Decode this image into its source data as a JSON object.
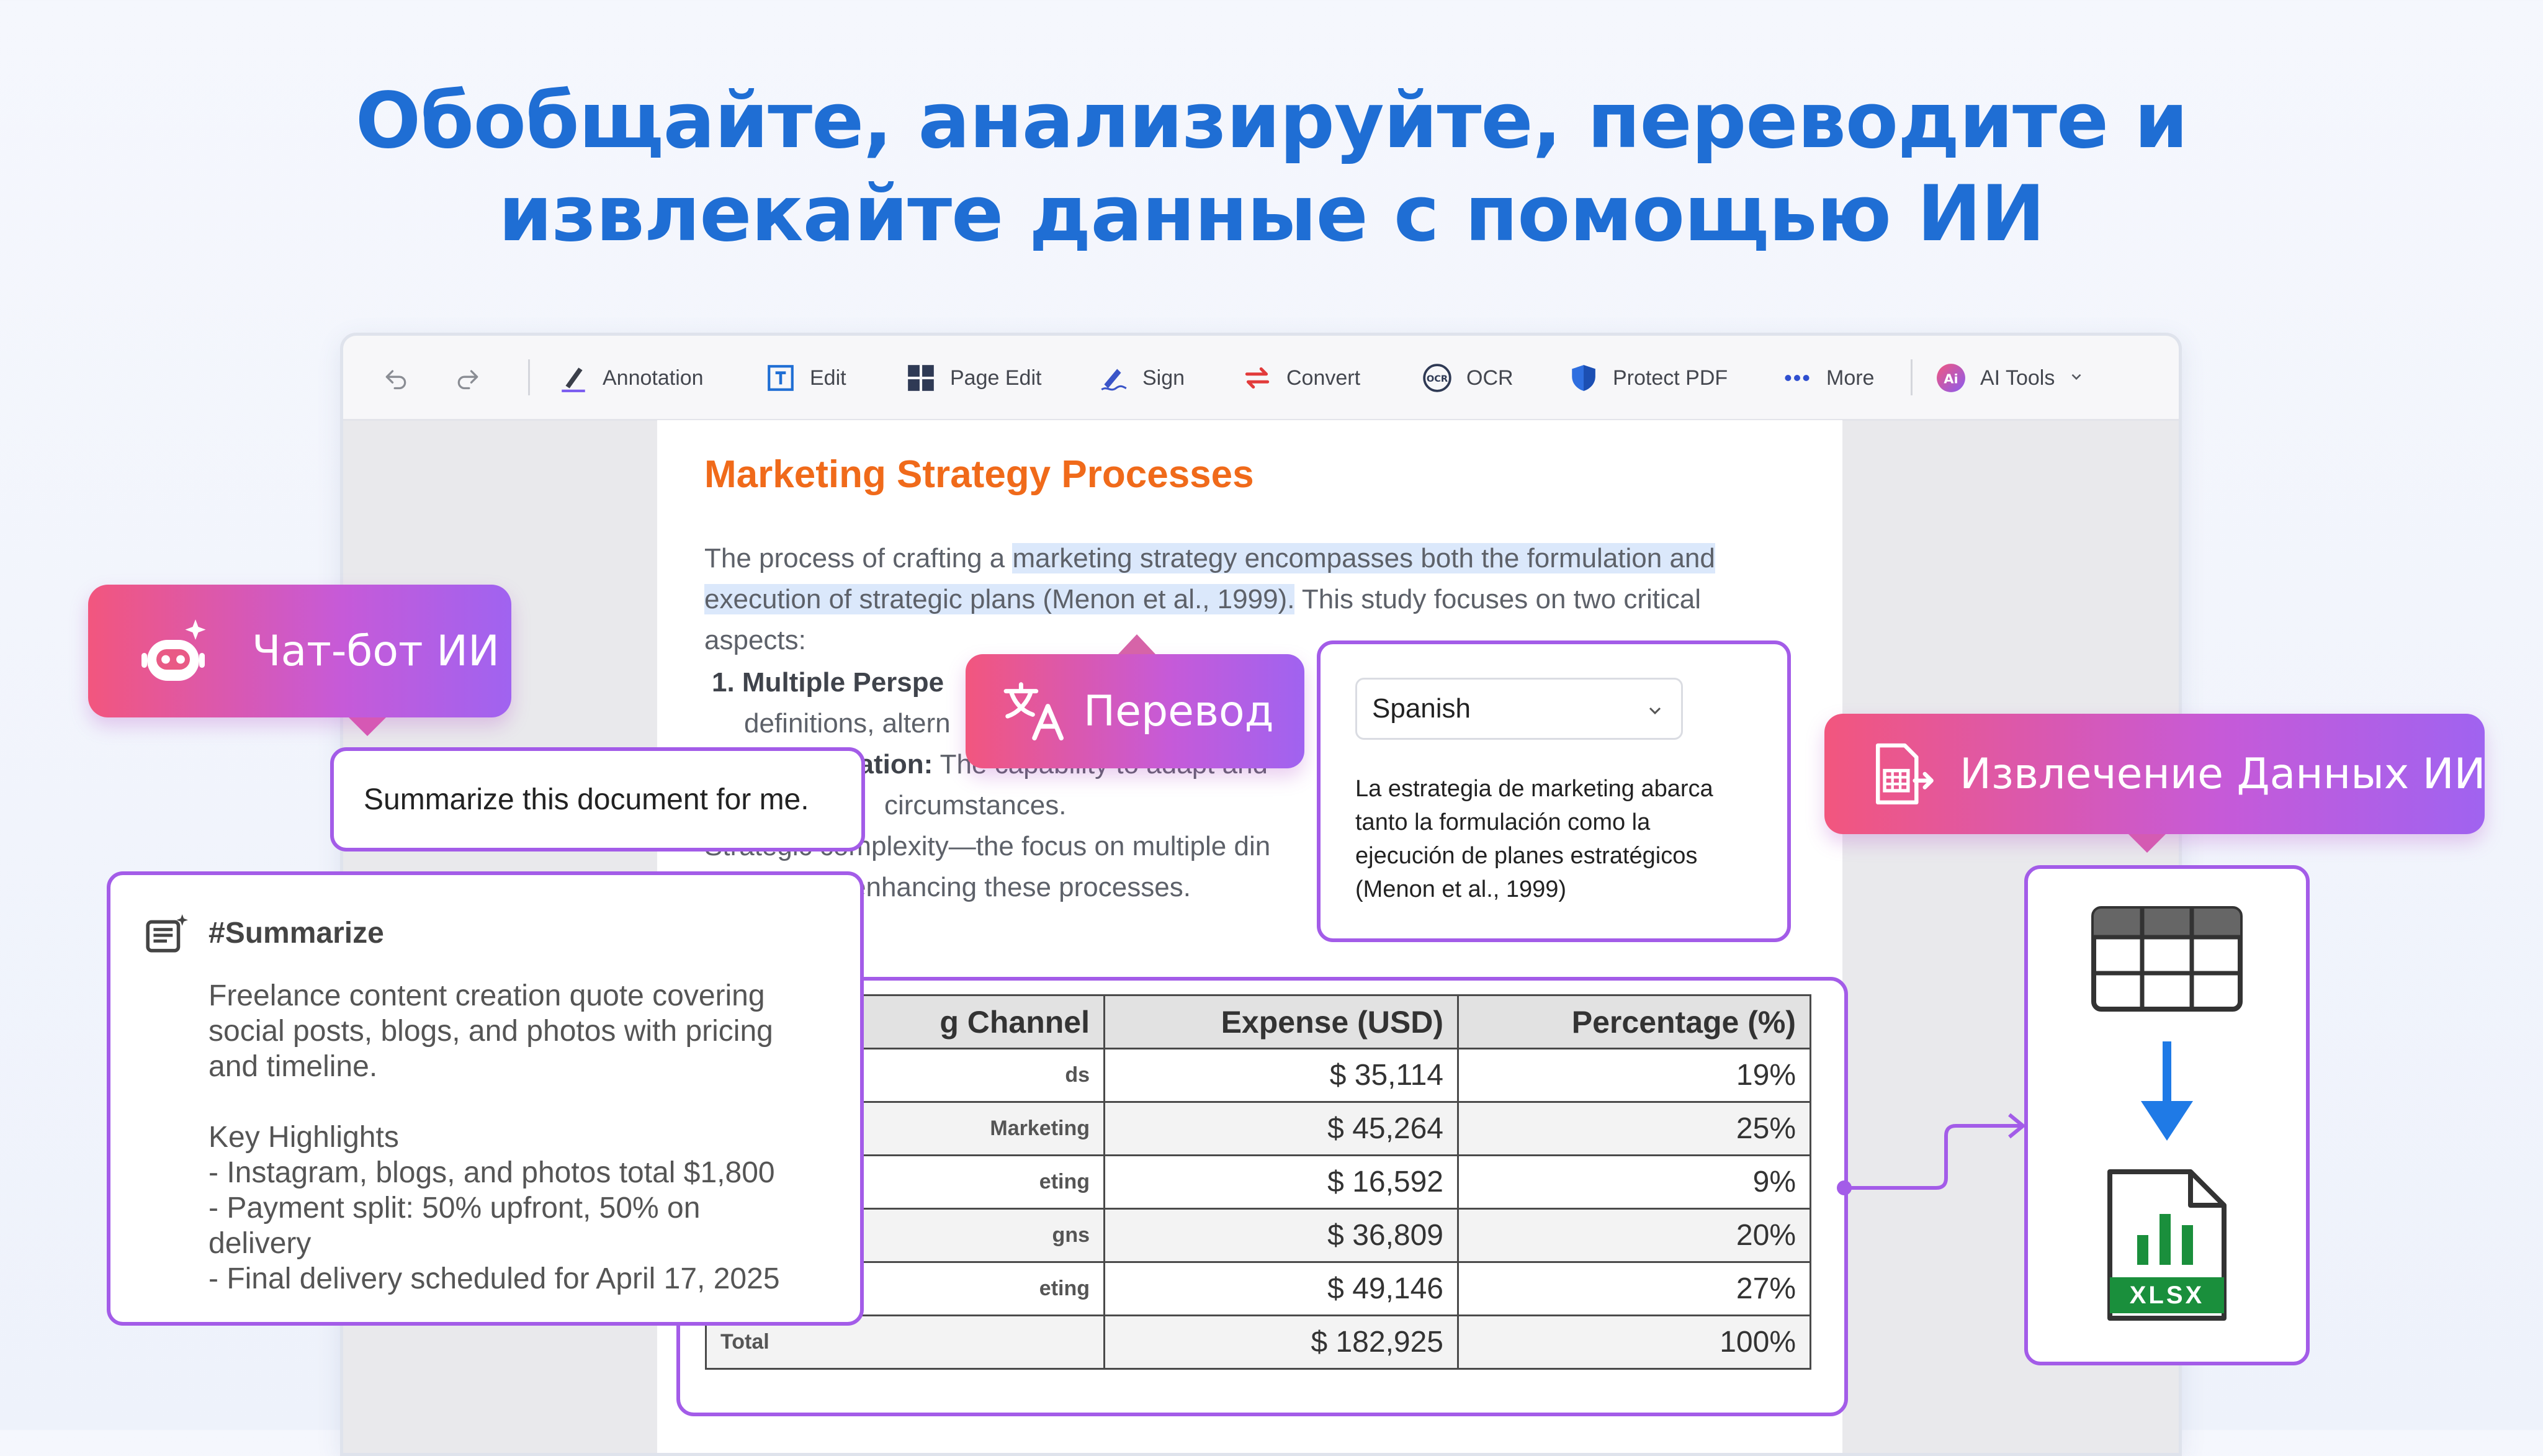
{
  "headline": {
    "line1": "Обобщайте, анализируйте, переводите и",
    "line2": "извлекайте данные с помощью ИИ"
  },
  "toolbar": {
    "items": [
      {
        "label": "Annotation",
        "icon": "pen-icon"
      },
      {
        "label": "Edit",
        "icon": "text-edit-icon"
      },
      {
        "label": "Page Edit",
        "icon": "grid-icon"
      },
      {
        "label": "Sign",
        "icon": "signature-icon"
      },
      {
        "label": "Convert",
        "icon": "convert-icon"
      },
      {
        "label": "OCR",
        "icon": "ocr-icon"
      },
      {
        "label": "Protect PDF",
        "icon": "shield-icon"
      },
      {
        "label": "More",
        "icon": "more-icon"
      },
      {
        "label": "AI Tools",
        "icon": "ai-icon"
      }
    ]
  },
  "document": {
    "title": "Marketing Strategy Processes",
    "p1_a": "The process of crafting a ",
    "p1_hl": "marketing strategy encompasses both the formulation and",
    "p2_hl": "execution of strategic plans (Menon et al., 1999).",
    "p2_b": " This study focuses on two critical",
    "p3": "aspects:",
    "item1": "1. Multiple Perspe",
    "item1_sub": "definitions, altern",
    "item2_a": "sation:",
    "item2_b": " The capability to adapt and",
    "item2_sub": "circumstances.",
    "p4": "Strategic complexity—the focus on multiple din",
    "p5": "enhancing these processes."
  },
  "table": {
    "headers": [
      "g Channel",
      "Expense (USD)",
      "Percentage (%)"
    ],
    "rows": [
      [
        "ds",
        "$ 35,114",
        "19%"
      ],
      [
        "Marketing",
        "$ 45,264",
        "25%"
      ],
      [
        "eting",
        "$ 16,592",
        "9%"
      ],
      [
        "gns",
        "$ 36,809",
        "20%"
      ],
      [
        "eting",
        "$ 49,146",
        "27%"
      ],
      [
        "Total",
        "$ 182,925",
        "100%"
      ]
    ]
  },
  "chatbot": {
    "label": "Чат-бот ИИ"
  },
  "prompt": {
    "text": "Summarize this document for me."
  },
  "summary": {
    "tag": "#Summarize",
    "lines": [
      "Freelance content creation quote covering",
      "social posts, blogs, and photos with pricing",
      "and timeline.",
      "",
      "Key Highlights",
      "- Instagram, blogs, and photos total $1,800",
      "- Payment split: 50% upfront, 50% on",
      "delivery",
      "- Final delivery scheduled for April 17, 2025"
    ]
  },
  "translate": {
    "label": "Перевод",
    "language": "Spanish",
    "result_lines": [
      "La estrategia de marketing abarca",
      "tanto la formulación como la",
      "ejecución de planes estratégicos",
      "(Menon et al., 1999)"
    ]
  },
  "extract": {
    "label": "Извлечение Данных ИИ",
    "file_badge": "XLSX"
  },
  "colors": {
    "headline": "#1f6ed4",
    "doc_title": "#f06a1a",
    "accent_purple": "#a35ce8",
    "gradient_start": "#f2567e",
    "gradient_end": "#a063f0",
    "highlight": "#dbe8fb",
    "xlsx_green": "#1a8f3c",
    "arrow_blue": "#1f7ae6"
  }
}
